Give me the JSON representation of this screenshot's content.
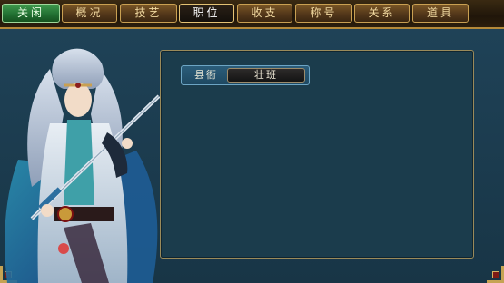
{
  "tabs": [
    {
      "label": "关闲",
      "state": "close"
    },
    {
      "label": "概况",
      "state": "normal"
    },
    {
      "label": "技艺",
      "state": "normal"
    },
    {
      "label": "职位",
      "state": "active"
    },
    {
      "label": "收支",
      "state": "normal"
    },
    {
      "label": "称号",
      "state": "normal"
    },
    {
      "label": "关系",
      "state": "normal"
    },
    {
      "label": "道具",
      "state": "normal"
    }
  ],
  "panel": {
    "post_label": "县衙",
    "post_value": "壮班"
  },
  "colors": {
    "tab_gold": "#c9a052",
    "tab_close_green": "#227133",
    "panel_bg": "#1b3c4c",
    "accent_blue": "#6da5c4"
  }
}
